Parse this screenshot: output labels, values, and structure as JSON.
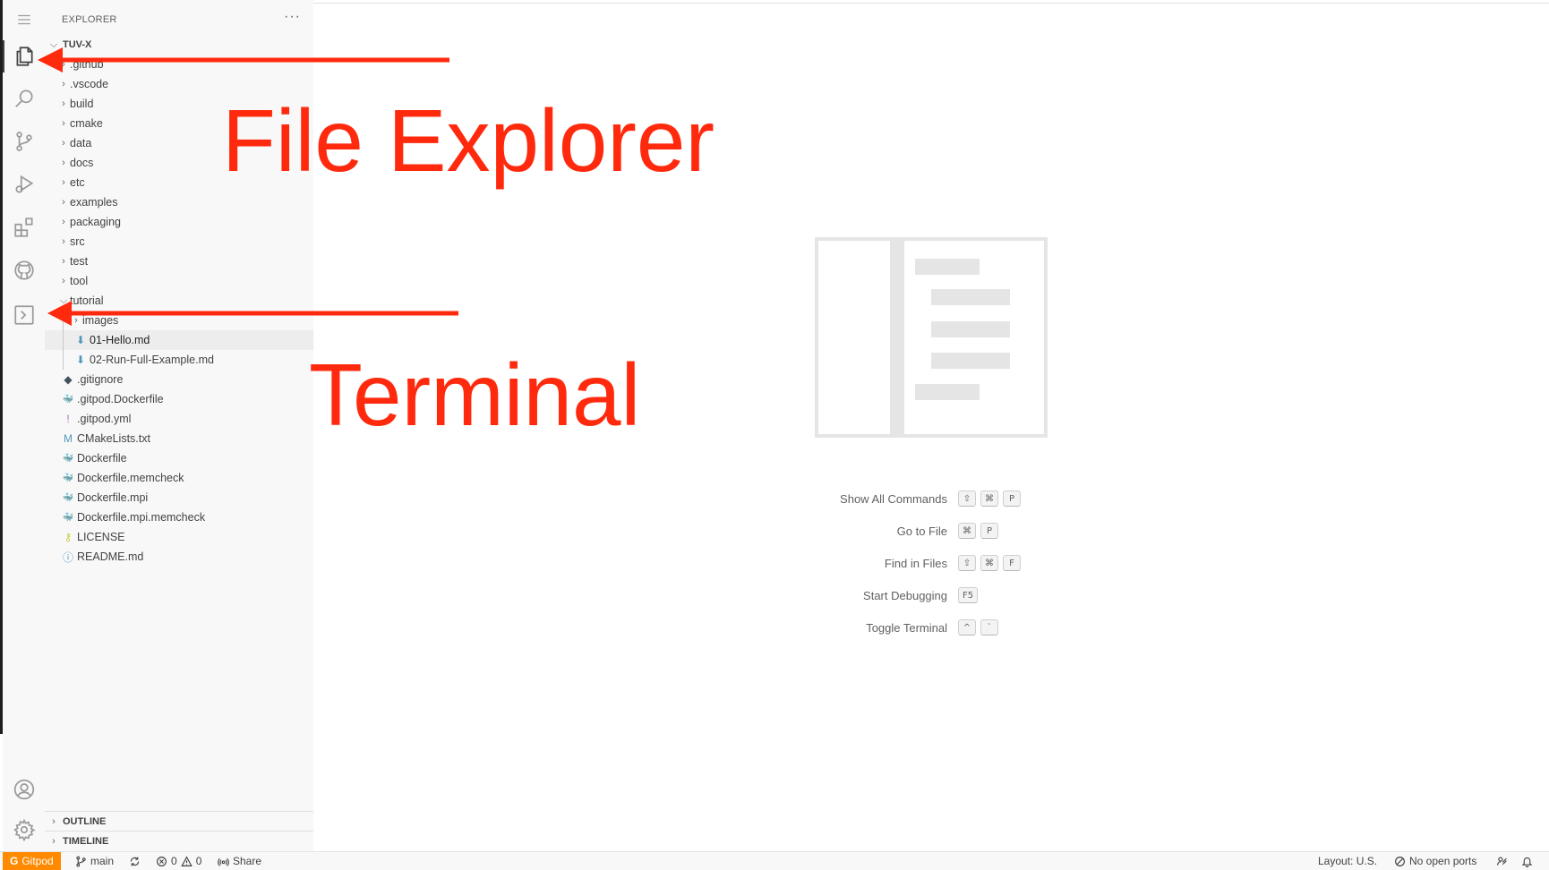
{
  "explorer": {
    "title": "EXPLORER",
    "more": "···",
    "root": "TUV-X",
    "items": [
      {
        "name": ".github",
        "kind": "folder"
      },
      {
        "name": ".vscode",
        "kind": "folder"
      },
      {
        "name": "build",
        "kind": "folder"
      },
      {
        "name": "cmake",
        "kind": "folder"
      },
      {
        "name": "data",
        "kind": "folder"
      },
      {
        "name": "docs",
        "kind": "folder"
      },
      {
        "name": "etc",
        "kind": "folder"
      },
      {
        "name": "examples",
        "kind": "folder"
      },
      {
        "name": "packaging",
        "kind": "folder"
      },
      {
        "name": "src",
        "kind": "folder"
      },
      {
        "name": "test",
        "kind": "folder"
      },
      {
        "name": "tool",
        "kind": "folder"
      },
      {
        "name": "tutorial",
        "kind": "folder-open"
      },
      {
        "name": "images",
        "kind": "folder"
      },
      {
        "name": "01-Hello.md",
        "kind": "markdown"
      },
      {
        "name": "02-Run-Full-Example.md",
        "kind": "markdown"
      },
      {
        "name": ".gitignore",
        "kind": "git"
      },
      {
        "name": ".gitpod.Dockerfile",
        "kind": "docker"
      },
      {
        "name": ".gitpod.yml",
        "kind": "yaml"
      },
      {
        "name": "CMakeLists.txt",
        "kind": "cmake"
      },
      {
        "name": "Dockerfile",
        "kind": "docker"
      },
      {
        "name": "Dockerfile.memcheck",
        "kind": "docker"
      },
      {
        "name": "Dockerfile.mpi",
        "kind": "docker"
      },
      {
        "name": "Dockerfile.mpi.memcheck",
        "kind": "docker"
      },
      {
        "name": "LICENSE",
        "kind": "license"
      },
      {
        "name": "README.md",
        "kind": "info"
      }
    ],
    "outline": "OUTLINE",
    "timeline": "TIMELINE"
  },
  "shortcuts": [
    {
      "label": "Show All Commands",
      "keys": [
        "⇧",
        "⌘",
        "P"
      ]
    },
    {
      "label": "Go to File",
      "keys": [
        "⌘",
        "P"
      ]
    },
    {
      "label": "Find in Files",
      "keys": [
        "⇧",
        "⌘",
        "F"
      ]
    },
    {
      "label": "Start Debugging",
      "keys": [
        "F5"
      ]
    },
    {
      "label": "Toggle Terminal",
      "keys": [
        "^",
        "`"
      ]
    }
  ],
  "annotations": {
    "explorer_label": "File Explorer",
    "terminal_label": "Terminal",
    "color": "#ff2a0e"
  },
  "statusbar": {
    "remote": "Gitpod",
    "branch": "main",
    "errors": "0",
    "warnings": "0",
    "share": "Share",
    "layout": "Layout: U.S.",
    "ports": "No open ports"
  },
  "colors": {
    "remote_bg": "#ff8a00",
    "sidebar_bg": "#f8f8f8"
  }
}
